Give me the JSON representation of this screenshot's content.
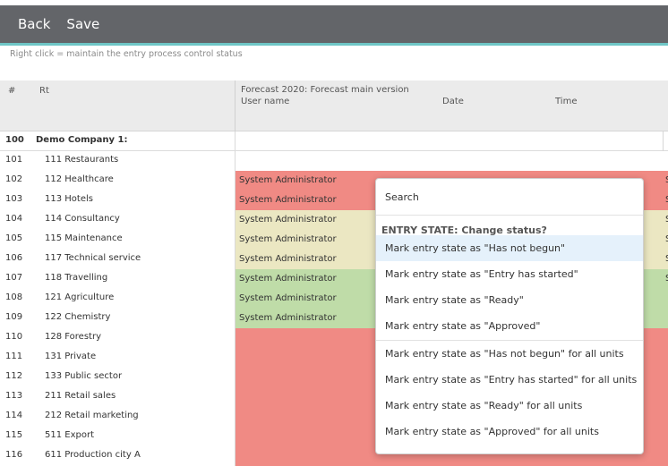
{
  "toolbar": {
    "back_label": "Back",
    "save_label": "Save"
  },
  "hint": "Right click = maintain the entry process control status",
  "header": {
    "num": "#",
    "rt": "Rt",
    "forecast": "Forecast 2020: Forecast main version",
    "user": "User name",
    "date": "Date",
    "time": "Time"
  },
  "group": {
    "num": "100",
    "name": "Demo Company 1:"
  },
  "rows": [
    {
      "num": "101",
      "name": "111 Restaurants",
      "user": "",
      "edge": "",
      "status": "none"
    },
    {
      "num": "102",
      "name": "112 Healthcare",
      "user": "System Administrator",
      "edge": "S",
      "status": "red"
    },
    {
      "num": "103",
      "name": "113 Hotels",
      "user": "System Administrator",
      "edge": "S",
      "status": "red"
    },
    {
      "num": "104",
      "name": "114 Consultancy",
      "user": "System Administrator",
      "edge": "S",
      "status": "yellow"
    },
    {
      "num": "105",
      "name": "115 Maintenance",
      "user": "System Administrator",
      "edge": "S",
      "status": "yellow"
    },
    {
      "num": "106",
      "name": "117 Technical service",
      "user": "System Administrator",
      "edge": "S",
      "status": "yellow"
    },
    {
      "num": "107",
      "name": "118 Travelling",
      "user": "System Administrator",
      "edge": "S",
      "status": "green"
    },
    {
      "num": "108",
      "name": "121 Agriculture",
      "user": "System Administrator",
      "edge": "",
      "status": "green"
    },
    {
      "num": "109",
      "name": "122 Chemistry",
      "user": "System Administrator",
      "edge": "",
      "status": "green"
    },
    {
      "num": "110",
      "name": "128 Forestry",
      "user": "",
      "edge": "",
      "status": "red"
    },
    {
      "num": "111",
      "name": "131 Private",
      "user": "",
      "edge": "",
      "status": "red"
    },
    {
      "num": "112",
      "name": "133 Public sector",
      "user": "",
      "edge": "",
      "status": "red"
    },
    {
      "num": "113",
      "name": "211 Retail sales",
      "user": "",
      "edge": "",
      "status": "red"
    },
    {
      "num": "114",
      "name": "212 Retail marketing",
      "user": "",
      "edge": "",
      "status": "red"
    },
    {
      "num": "115",
      "name": "511 Export",
      "user": "",
      "edge": "",
      "status": "red"
    },
    {
      "num": "116",
      "name": "611 Production city A",
      "user": "",
      "edge": "",
      "status": "red"
    }
  ],
  "colors": {
    "red": "#f08a84",
    "yellow": "#ebe7c2",
    "green": "#bfdca8",
    "none": "#ffffff",
    "toolbar": "#636569",
    "accent": "#6ec6c6"
  },
  "popup": {
    "search": "Search",
    "section": "ENTRY STATE: Change status?",
    "items": [
      "Mark entry state as \"Has not begun\"",
      "Mark entry state as \"Entry has started\"",
      "Mark entry state as \"Ready\"",
      "Mark entry state as \"Approved\"",
      "Mark entry state as \"Has not begun\" for all units",
      "Mark entry state as \"Entry has started\" for all units",
      "Mark entry state as \"Ready\" for all units",
      "Mark entry state as \"Approved\" for all units"
    ]
  }
}
